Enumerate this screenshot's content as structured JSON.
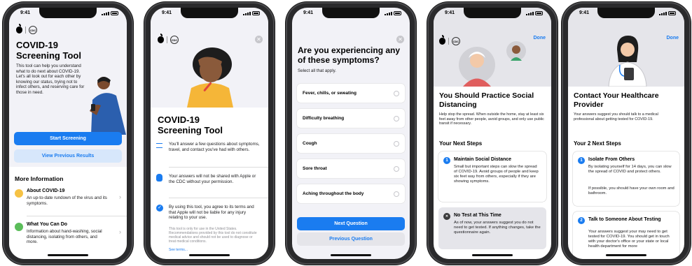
{
  "status_time": "9:41",
  "logo_cdc": "CDC",
  "screen1": {
    "title": "COVID-19 Screening Tool",
    "desc": "This tool can help you understand what to do next about COVID-19. Let's all look out for each other by knowing our status, trying not to infect others, and reserving care for those in need.",
    "start_button": "Start Screening",
    "previous_button": "View Previous Results",
    "more_info_header": "More Information",
    "items": [
      {
        "title": "About COVID-19",
        "desc": "An up-to-date rundown of the virus and its symptoms."
      },
      {
        "title": "What You Can Do",
        "desc": "Information about hand-washing, social distancing, isolating from others, and more."
      }
    ]
  },
  "screen2": {
    "title": "COVID-19 Screening Tool",
    "items": [
      "You'll answer a few questions about symptoms, travel, and contact you've had with others.",
      "Your answers will not be shared with Apple or the CDC without your permission.",
      "By using this tool, you agree to its terms and that Apple will not be liable for any injury relating to your use."
    ],
    "fine_print": "This tool is only for use in the United States. Recommendations provided by this tool do not constitute medical advice and should not be used to diagnose or treat medical conditions.",
    "see_terms": "See terms..."
  },
  "screen3": {
    "title": "Are you experiencing any of these symptoms?",
    "subtitle": "Select all that apply.",
    "symptoms": [
      "Fever, chills, or sweating",
      "Difficulty breathing",
      "Cough",
      "Sore throat",
      "Aching throughout the body"
    ],
    "next_button": "Next Question",
    "previous_button": "Previous Question"
  },
  "screen4": {
    "done": "Done",
    "title": "You Should Practice Social Distancing",
    "desc": "Help stop the spread. When outside the home, stay at least six feet away from other people, avoid groups, and only use public transit if necessary.",
    "steps_header": "Your Next Steps",
    "step1_num": "1",
    "step1_title": "Maintain Social Distance",
    "step1_desc": "Small but important steps can slow the spread of COVID-19. Avoid groups of people and keep six feet way from others, especially if they are showing symptoms.",
    "step2_icon": "✕",
    "step2_title": "No Test at This Time",
    "step2_desc": "As of now, your answers suggest you do not need to get tested. If anything changes, take the questionnaire again."
  },
  "screen5": {
    "done": "Done",
    "title": "Contact Your Healthcare Provider",
    "desc": "Your answers suggest you should talk to a medical professional about getting tested for COVID-19.",
    "steps_header": "Your 2 Next Steps",
    "step1_num": "1",
    "step1_title": "Isolate From Others",
    "step1_desc": "By isolating yourself for 14 days, you can slow the spread of COVID and protect others.",
    "step1_desc2": "If possible, you should have your own room and bathroom.",
    "step2_num": "2",
    "step2_title": "Talk to Someone About Testing",
    "step2_desc": "Your answers suggest your may need to get tested for COVID-19. You should get in touch with your doctor's office or your state or local health department for more"
  },
  "colors": {
    "accent": "#1a7cf0",
    "light_accent": "#d7e7fb",
    "gray_bg": "#f2f2f7"
  }
}
